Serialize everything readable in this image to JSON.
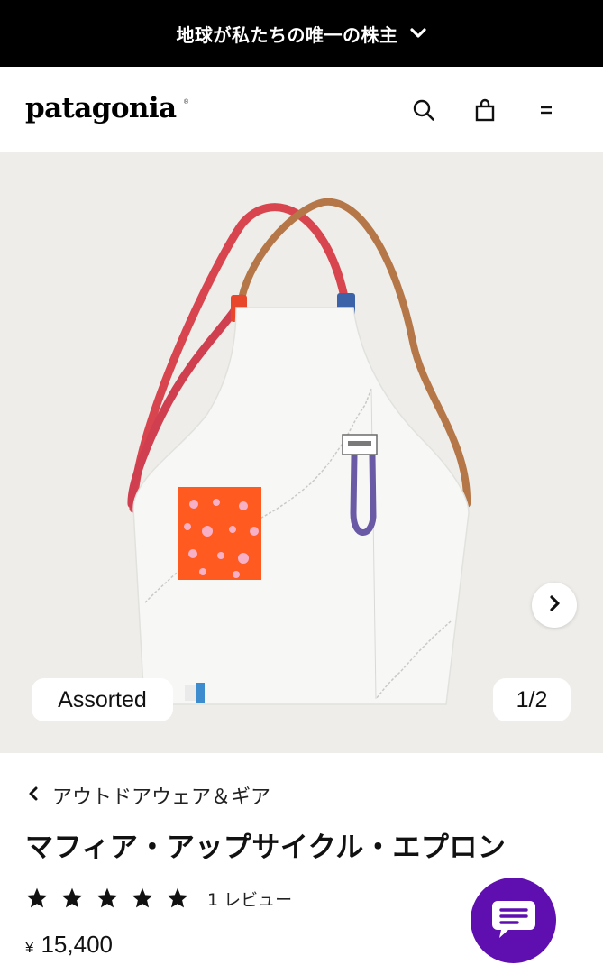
{
  "promo_banner": {
    "text": "地球が私たちの唯一の株主"
  },
  "header": {
    "logo": "patagonia",
    "logo_mark": "®",
    "icons": [
      "search-icon",
      "bag-icon",
      "menu-icon"
    ]
  },
  "gallery": {
    "color_label": "Assorted",
    "counter": "1/2",
    "background": "#eeede9"
  },
  "product": {
    "breadcrumb": "アウトドアウェア＆ギア",
    "title": "マフィア・アップサイクル・エプロン",
    "rating_stars": 5,
    "review_count": "1 レビュー",
    "currency": "¥",
    "price": "15,400"
  },
  "colors": {
    "promo_bg": "#000000",
    "chat_bg": "#5f0fb0",
    "pocket": "#ff5a1f"
  }
}
